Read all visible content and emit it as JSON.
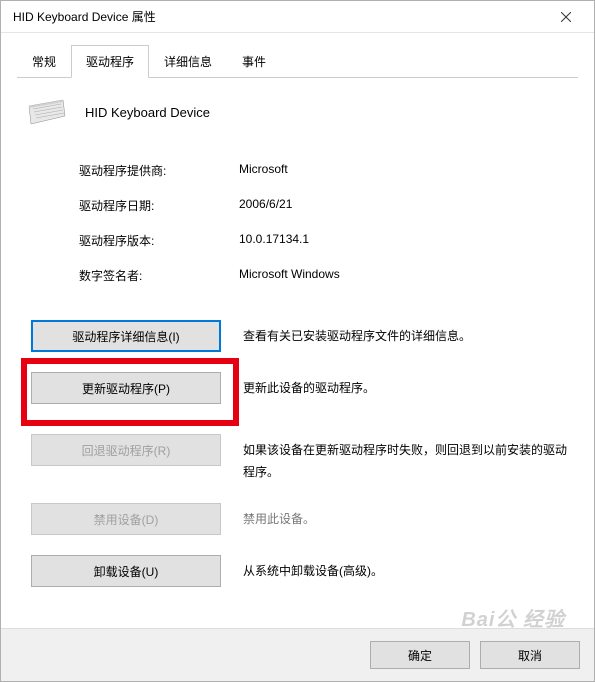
{
  "window": {
    "title": "HID Keyboard Device 属性"
  },
  "tabs": {
    "general": "常规",
    "driver": "驱动程序",
    "details": "详细信息",
    "events": "事件"
  },
  "device": {
    "name": "HID Keyboard Device"
  },
  "info": {
    "provider_label": "驱动程序提供商:",
    "provider_value": "Microsoft",
    "date_label": "驱动程序日期:",
    "date_value": "2006/6/21",
    "version_label": "驱动程序版本:",
    "version_value": "10.0.17134.1",
    "signer_label": "数字签名者:",
    "signer_value": "Microsoft Windows"
  },
  "actions": {
    "details_btn": "驱动程序详细信息(I)",
    "details_desc": "查看有关已安装驱动程序文件的详细信息。",
    "update_btn": "更新驱动程序(P)",
    "update_desc": "更新此设备的驱动程序。",
    "rollback_btn": "回退驱动程序(R)",
    "rollback_desc": "如果该设备在更新驱动程序时失败，则回退到以前安装的驱动程序。",
    "disable_btn": "禁用设备(D)",
    "disable_desc": "禁用此设备。",
    "uninstall_btn": "卸载设备(U)",
    "uninstall_desc": "从系统中卸载设备(高级)。"
  },
  "footer": {
    "ok": "确定",
    "cancel": "取消"
  },
  "watermark": {
    "main": "Bai公 经验",
    "sub": ""
  }
}
